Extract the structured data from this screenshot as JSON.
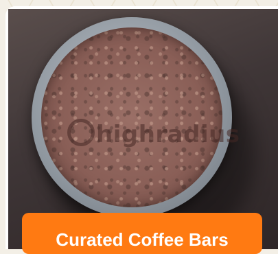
{
  "watermark": {
    "text": "highradius"
  },
  "banner": {
    "label": "Curated Coffee Bars"
  },
  "colors": {
    "accent": "#ff7a12",
    "coffee": "#8a5f57",
    "cup": "#8f979f"
  },
  "icons": {
    "watermark_logo": "ring-icon"
  }
}
